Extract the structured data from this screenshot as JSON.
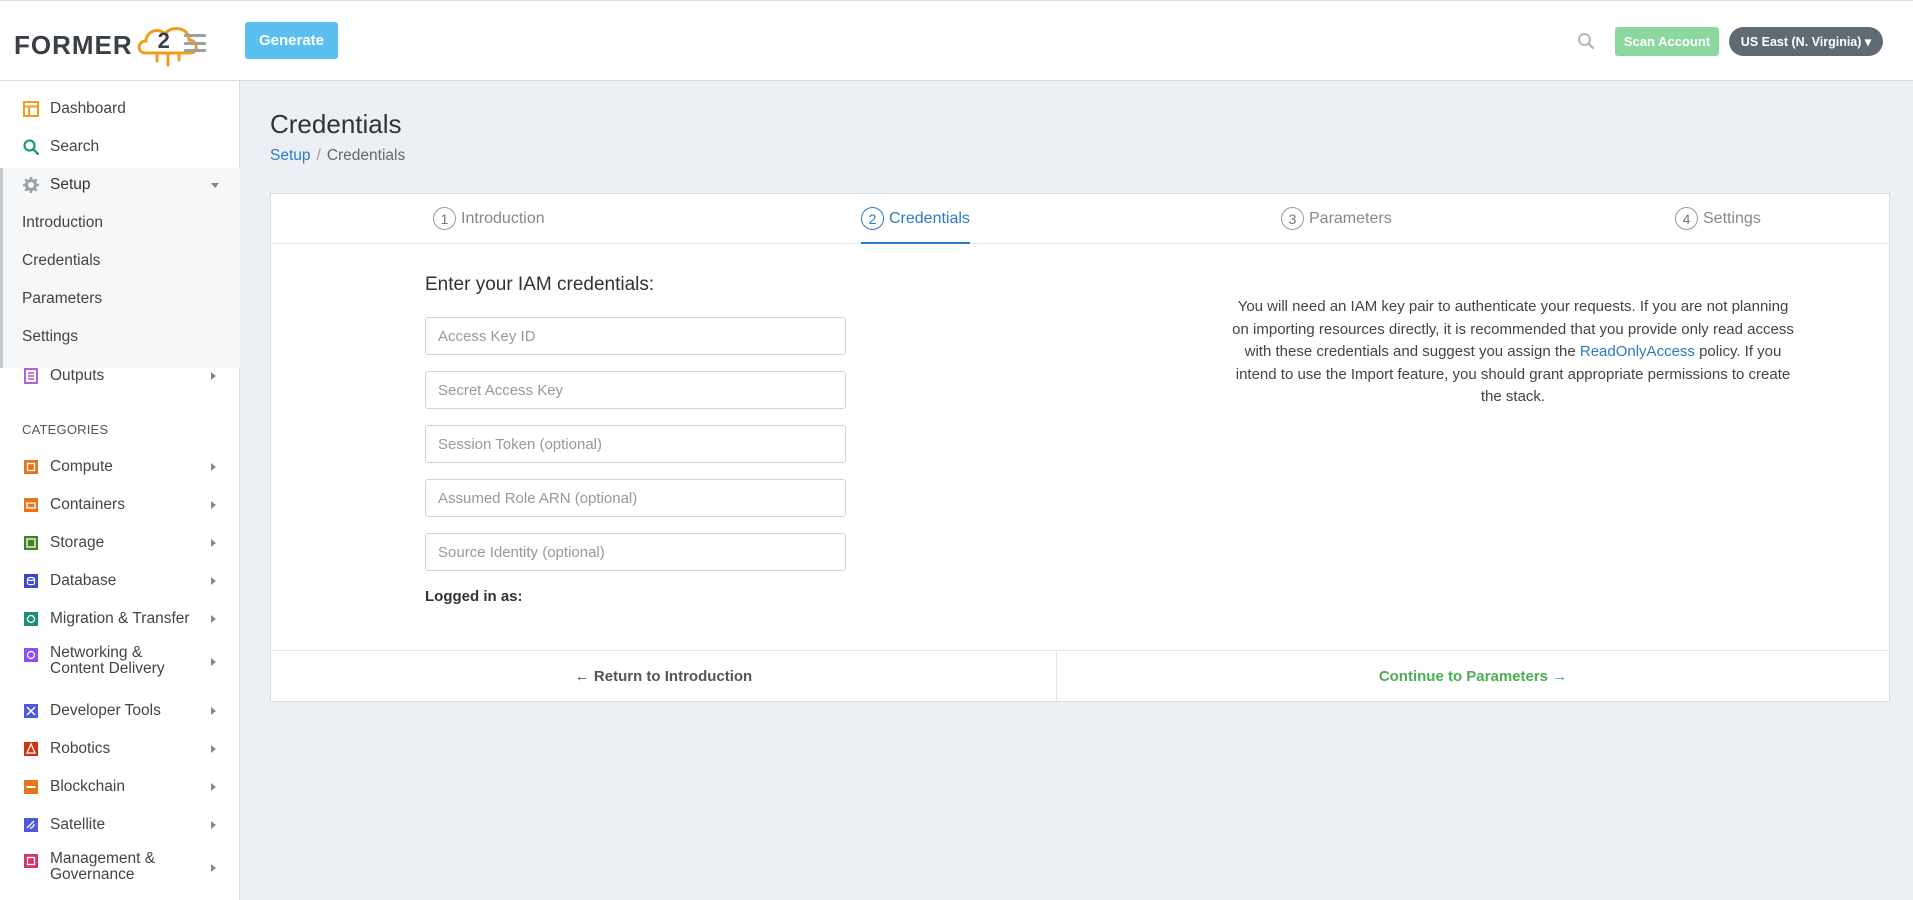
{
  "header": {
    "logo_text": "FORMER",
    "logo_number": "2",
    "generate_label": "Generate",
    "scan_label": "Scan Account",
    "region_label": "US East (N. Virginia) ▾"
  },
  "sidebar": {
    "top_items": [
      {
        "label": "Dashboard",
        "icon": "dashboard-icon"
      },
      {
        "label": "Search",
        "icon": "search-icon"
      },
      {
        "label": "Setup",
        "icon": "gear-icon"
      }
    ],
    "setup_children": [
      "Introduction",
      "Credentials",
      "Parameters",
      "Settings"
    ],
    "outputs_label": "Outputs",
    "categories_title": "CATEGORIES",
    "categories": [
      {
        "label": "Compute",
        "color": "#e8741c"
      },
      {
        "label": "Containers",
        "color": "#e8741c"
      },
      {
        "label": "Storage",
        "color": "#3f8624"
      },
      {
        "label": "Database",
        "color": "#3b48cc"
      },
      {
        "label": "Migration & Transfer",
        "color": "#1b8f7a"
      },
      {
        "label": "Networking &",
        "label2": "Content Delivery",
        "color": "#8c4fff"
      },
      {
        "label": "Developer Tools",
        "color": "#4d5bd9"
      },
      {
        "label": "Robotics",
        "color": "#d13212"
      },
      {
        "label": "Blockchain",
        "color": "#e8741c"
      },
      {
        "label": "Satellite",
        "color": "#4d5bd9"
      },
      {
        "label": "Management &",
        "label2": "Governance",
        "color": "#d6336c"
      }
    ]
  },
  "main": {
    "title": "Credentials",
    "breadcrumb": {
      "root": "Setup",
      "sep": "/",
      "current": "Credentials"
    },
    "steps": [
      {
        "num": "1",
        "label": "Introduction"
      },
      {
        "num": "2",
        "label": "Credentials"
      },
      {
        "num": "3",
        "label": "Parameters"
      },
      {
        "num": "4",
        "label": "Settings"
      }
    ],
    "form_title": "Enter your IAM credentials:",
    "fields": {
      "access_key": "Access Key ID",
      "secret_key": "Secret Access Key",
      "session_token": "Session Token (optional)",
      "role_arn": "Assumed Role ARN (optional)",
      "source_identity": "Source Identity (optional)"
    },
    "logged_in_label": "Logged in as:",
    "logged_in_value": "",
    "info": {
      "before_link": "You will need an IAM key pair to authenticate your requests. If you are not planning on importing resources directly, it is recommended that you provide only read access with these credentials and suggest you assign the ",
      "link": "ReadOnlyAccess",
      "after_link": " policy. If you intend to use the Import feature, you should grant appropriate permissions to create the stack."
    },
    "footer": {
      "back_label": "← Return to Introduction",
      "next_label": "Continue to Parameters →"
    }
  },
  "colors": {
    "accent": "#2a7ac7",
    "generate": "#5bc0f0",
    "scan": "#8cd79e",
    "continue": "#4caf50",
    "logo_orange": "#f29c1f"
  }
}
